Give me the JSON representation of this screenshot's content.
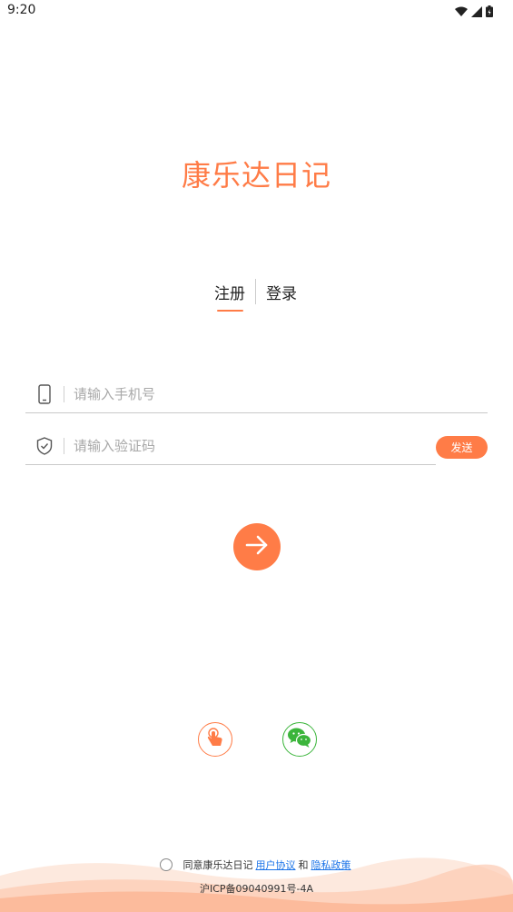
{
  "status_bar": {
    "time": "9:20",
    "icons": [
      "wifi-icon",
      "signal-icon",
      "battery-icon"
    ]
  },
  "app": {
    "title": "康乐达日记"
  },
  "tabs": {
    "register": "注册",
    "login": "登录",
    "active": "register"
  },
  "form": {
    "phone_placeholder": "请输入手机号",
    "code_placeholder": "请输入验证码",
    "send_label": "发送",
    "phone_icon": "phone-icon",
    "code_icon": "shield-check-icon",
    "submit_icon": "arrow-right-icon"
  },
  "alt_login": {
    "items": [
      {
        "icon": "touch-icon"
      },
      {
        "icon": "wechat-icon"
      }
    ]
  },
  "agreement": {
    "prefix": "同意康乐达日记",
    "user_agreement": "用户协议",
    "and": "和",
    "privacy_policy": "隐私政策"
  },
  "footer": {
    "icp": "沪ICP备09040991号-4A"
  },
  "colors": {
    "accent": "#ff7c47",
    "wechat": "#3bb53b",
    "link": "#1a73e8"
  }
}
